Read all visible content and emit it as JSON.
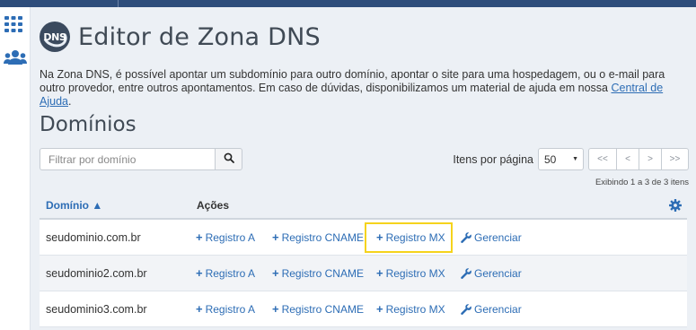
{
  "header": {
    "title": "Editor de Zona DNS",
    "logo_text": "DNS"
  },
  "sidebar": {
    "items": [
      {
        "icon": "apps-grid-icon"
      },
      {
        "icon": "users-icon"
      }
    ]
  },
  "intro": {
    "text": "Na Zona DNS, é possível apontar um subdomínio para outro domínio, apontar o site para uma hospedagem, ou o e-mail para outro provedor, entre outros apontamentos. Em caso de dúvidas, disponibilizamos um material de ajuda em nossa ",
    "link_text": "Central de Ajuda",
    "suffix": "."
  },
  "domains": {
    "section_title": "Domínios",
    "filter_placeholder": "Filtrar por domínio",
    "per_page_label": "Itens por página",
    "per_page_value": "50",
    "pager": {
      "first": "<<",
      "prev": "<",
      "next": ">",
      "last": ">>"
    },
    "showing_text": "Exibindo 1 a 3 de 3 itens",
    "columns": {
      "domain": "Domínio ▲",
      "actions": "Ações"
    },
    "actions": {
      "record_a": "Registro A",
      "record_cname": "Registro CNAME",
      "record_mx": "Registro MX",
      "manage": "Gerenciar"
    },
    "rows": [
      {
        "domain": "seudominio.com.br"
      },
      {
        "domain": "seudominio2.com.br"
      },
      {
        "domain": "seudominio3.com.br"
      }
    ]
  },
  "colors": {
    "accent": "#2d6db5",
    "topbar": "#2e4d7b",
    "highlight": "#f5d31c"
  }
}
